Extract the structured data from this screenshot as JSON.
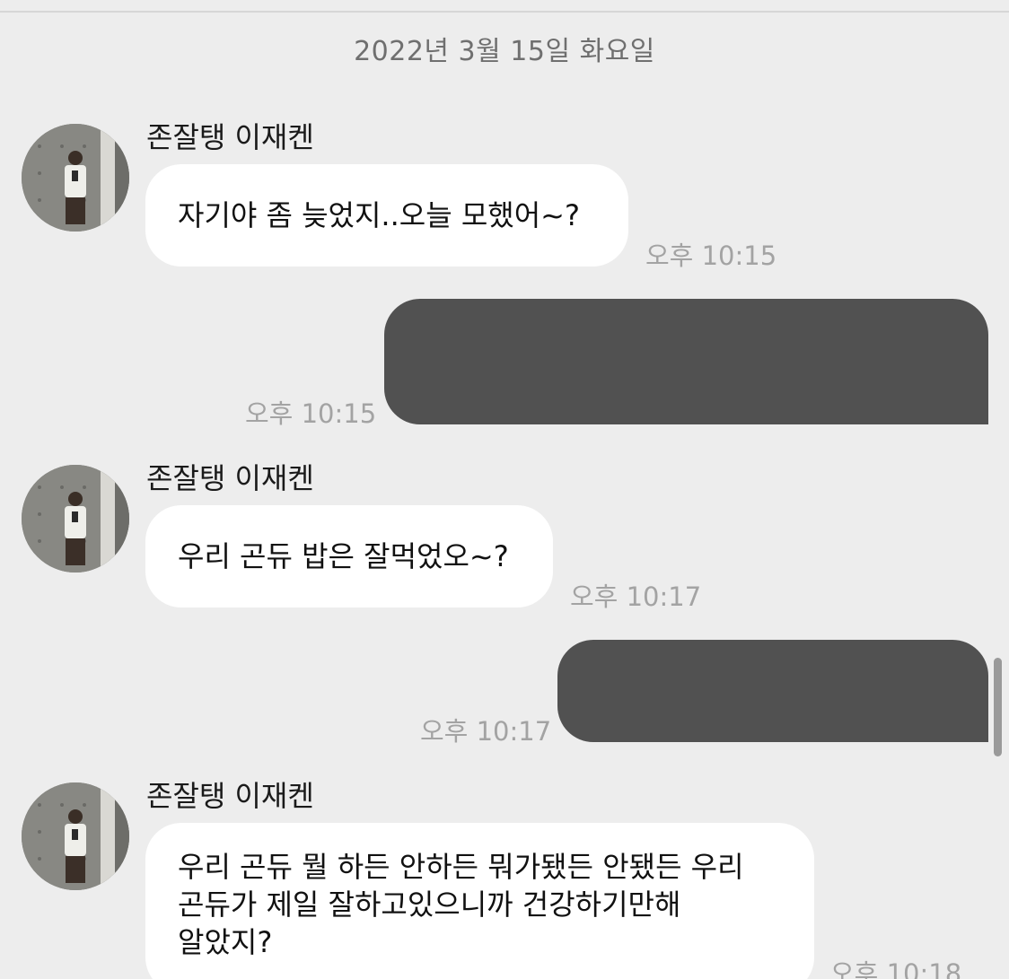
{
  "chat": {
    "date_separator": "2022년 3월 15일 화요일",
    "messages": [
      {
        "sender": "존잘탱 이재켄",
        "avatar_icon": "profile-photo",
        "text": "자기야 좀 늦었지..오늘 모했어~?",
        "time": "오후 10:15"
      },
      {
        "outgoing": true,
        "text": "",
        "time": "오후 10:15"
      },
      {
        "sender": "존잘탱 이재켄",
        "avatar_icon": "profile-photo",
        "text": "우리 곤듀 밥은 잘먹었오~?",
        "time": "오후 10:17"
      },
      {
        "outgoing": true,
        "text": "",
        "time": "오후 10:17"
      },
      {
        "sender": "존잘탱 이재켄",
        "avatar_icon": "profile-photo",
        "text": "우리 곤듀 뭘 하든 안하든 뭐가됐든 안됐든 우리\n곤듀가 제일 잘하고있으니까 건강하기만해\n알았지?",
        "time": "오후 10:18"
      }
    ]
  },
  "colors": {
    "background": "#ededed",
    "incoming_bubble": "#ffffff",
    "outgoing_bubble_redacted": "#515151",
    "timestamp": "#a3a3a3"
  }
}
